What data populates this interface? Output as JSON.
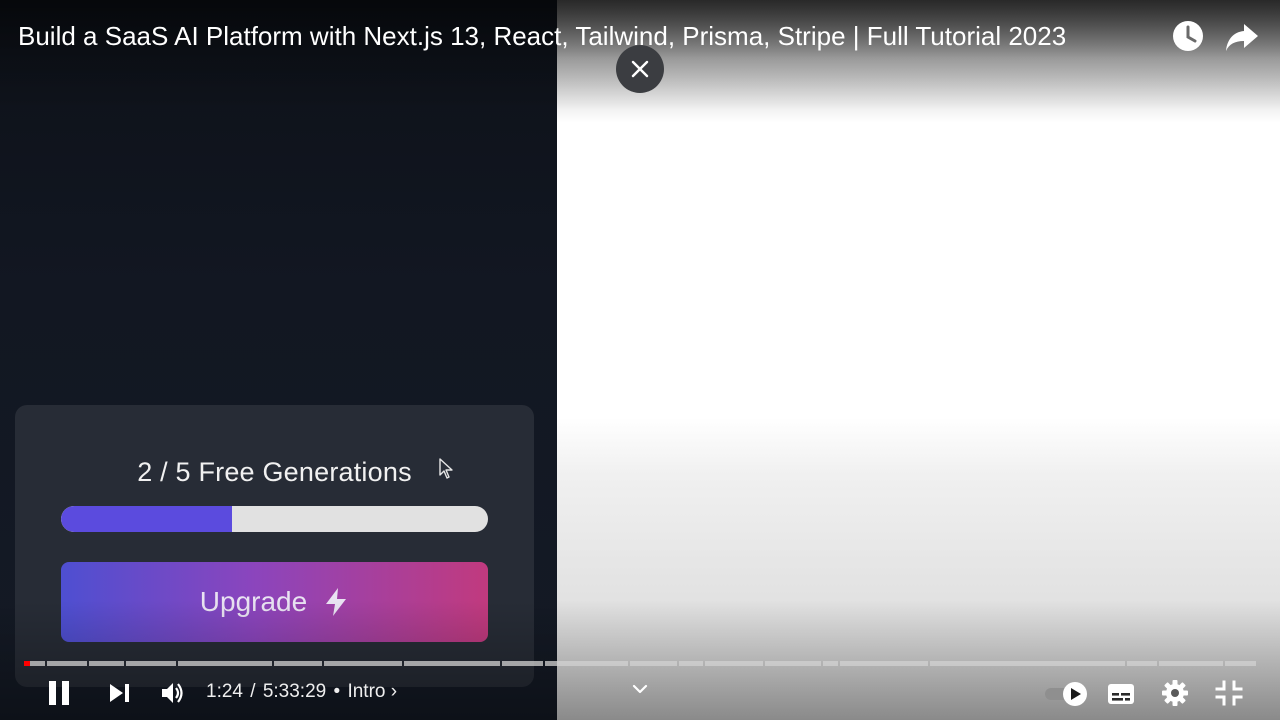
{
  "video": {
    "title": "Build a SaaS AI Platform with Next.js 13, React, Tailwind, Prisma, Stripe | Full Tutorial 2023"
  },
  "card": {
    "generations_text": "2 / 5 Free Generations",
    "generations_used": 2,
    "generations_total": 5,
    "upgrade_label": "Upgrade"
  },
  "player": {
    "current_time": "1:24",
    "time_separator": "/",
    "duration": "5:33:29",
    "chapter_separator": "•",
    "chapter": "Intro",
    "chapter_arrow": "›",
    "icons": {
      "watch_later": "clock-icon",
      "share": "share-arrow-icon",
      "close": "close-icon",
      "pause": "pause-icon",
      "next": "next-icon",
      "volume": "volume-icon",
      "expand": "chevron-down-icon",
      "autoplay": "autoplay-toggle-icon",
      "subtitles": "subtitles-icon",
      "settings": "gear-icon",
      "exit_fullscreen": "exit-fullscreen-icon"
    },
    "colors": {
      "played": "#ff0000",
      "progress_fill": "#5b4bde",
      "upgrade_start": "#4e4fd1",
      "upgrade_end": "#c13a7e"
    },
    "playback_fraction": 0.0042
  }
}
